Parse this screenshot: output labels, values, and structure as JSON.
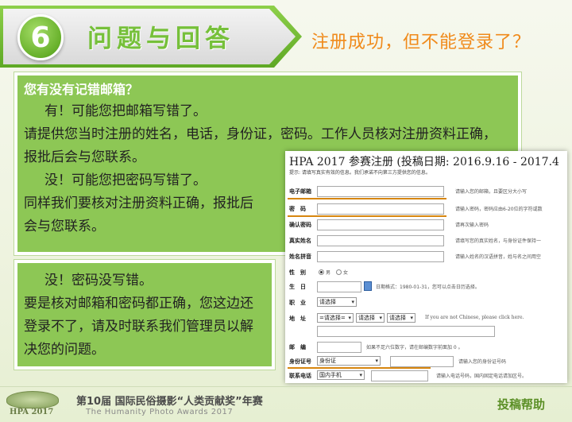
{
  "header": {
    "number": "6",
    "title": "问题与回答",
    "subtitle": "注册成功，但不能登录了？"
  },
  "box1": {
    "question": "您有没有记错邮箱？",
    "lines": [
      "有！可能您把邮箱写错了。",
      "请提供您当时注册的姓名，电话，身份证，密码。工作人员核对注册资料正确，",
      "报批后会与您联系。",
      "没！可能您把密码写错了。",
      "同样我们要核对注册资料正确，报批后",
      "会与您联系。"
    ]
  },
  "box2": {
    "lines": [
      "没！密码没写错。",
      "要是核对邮箱和密码都正确，您这边还",
      "登录不了，请及时联系我们管理员以解",
      "决您的问题。"
    ]
  },
  "form": {
    "title": "HPA 2017 参赛注册 (投稿日期: 2016.9.16 - 2017.4",
    "tip": "提示: 请填写真实有效的信息。我们承诺不向第三方提供您的信息。",
    "email_label": "电子邮箱",
    "email_hint": "请输入您的邮箱，且要区分大小写",
    "password_label": "密　码",
    "password_hint": "请输入密码，密码应由6-20位的字符或数",
    "confirm_label": "确认密码",
    "confirm_hint": "请再次输入密码",
    "realname_label": "真实姓名",
    "realname_hint": "请填写您的真实姓名，与身份证件保持一",
    "pinyin_label": "姓名拼音",
    "pinyin_hint": "请输入姓名的汉语拼音，姓与名之间用空",
    "gender_label": "性　别",
    "gender_male": "男",
    "gender_female": "女",
    "birthday_label": "生　日",
    "birthday_hint": "日期格式：1980-01-31，您可以点击日历选择。",
    "job_label": "职　业",
    "job_select": "请选择",
    "address_label": "地　址",
    "address_select1": "=请选择=",
    "address_select2": "请选择",
    "address_select3": "请选择",
    "address_hint": "If you are not Chinese, please click here.",
    "postcode_label": "邮　编",
    "postcode_hint": "如果不足六位数字，请在邮编数字前面加 0 。",
    "idcard_label": "身份证号",
    "idcard_select": "身份证",
    "idcard_hint": "请输入您的身份证号码",
    "phone_label": "联系电话",
    "phone_select": "国内手机",
    "phone_hint": "请输入电话号码，国内固定电话请加区号。"
  },
  "footer": {
    "logo_text": "HPA 2017",
    "title_cn": "第10届 国际民俗摄影“人类贡献奖”年赛",
    "title_en": "The Humanity Photo Awards 2017",
    "help": "投稿帮助"
  },
  "colors": {
    "accent_green": "#8dc755",
    "title_orange": "#f08a1b",
    "underline_orange": "#d7860f"
  }
}
